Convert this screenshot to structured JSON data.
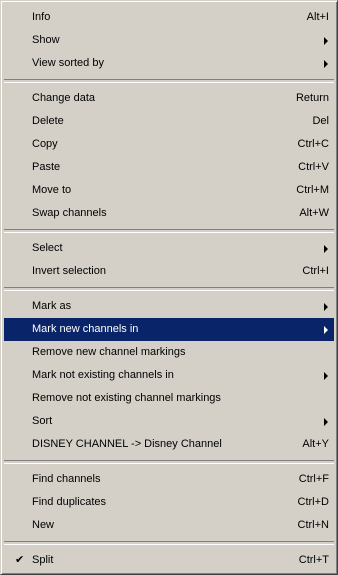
{
  "menu": {
    "groups": [
      {
        "items": [
          {
            "label": "Info",
            "shortcut": "Alt+I"
          },
          {
            "label": "Show",
            "submenu": true
          },
          {
            "label": "View sorted by",
            "submenu": true
          }
        ]
      },
      {
        "items": [
          {
            "label": "Change data",
            "shortcut": "Return"
          },
          {
            "label": "Delete",
            "shortcut": "Del"
          },
          {
            "label": "Copy",
            "shortcut": "Ctrl+C"
          },
          {
            "label": "Paste",
            "shortcut": "Ctrl+V"
          },
          {
            "label": "Move to",
            "shortcut": "Ctrl+M"
          },
          {
            "label": "Swap channels",
            "shortcut": "Alt+W"
          }
        ]
      },
      {
        "items": [
          {
            "label": "Select",
            "submenu": true
          },
          {
            "label": "Invert selection",
            "shortcut": "Ctrl+I"
          }
        ]
      },
      {
        "items": [
          {
            "label": "Mark as",
            "submenu": true
          },
          {
            "label": "Mark new channels in",
            "submenu": true,
            "highlighted": true
          },
          {
            "label": "Remove new channel markings"
          },
          {
            "label": "Mark not existing channels in",
            "submenu": true
          },
          {
            "label": "Remove not existing channel markings"
          },
          {
            "label": "Sort",
            "submenu": true
          },
          {
            "label": "DISNEY CHANNEL -> Disney Channel",
            "shortcut": "Alt+Y"
          }
        ]
      },
      {
        "items": [
          {
            "label": "Find channels",
            "shortcut": "Ctrl+F"
          },
          {
            "label": "Find duplicates",
            "shortcut": "Ctrl+D"
          },
          {
            "label": "New",
            "shortcut": "Ctrl+N"
          }
        ]
      },
      {
        "items": [
          {
            "label": "Split",
            "shortcut": "Ctrl+T",
            "checked": true,
            "check_glyph": "✔"
          }
        ]
      }
    ],
    "colors": {
      "menu_bg": "#d4d0c8",
      "highlight_bg": "#0a246a",
      "highlight_text": "#ffffff",
      "text": "#000000"
    }
  }
}
